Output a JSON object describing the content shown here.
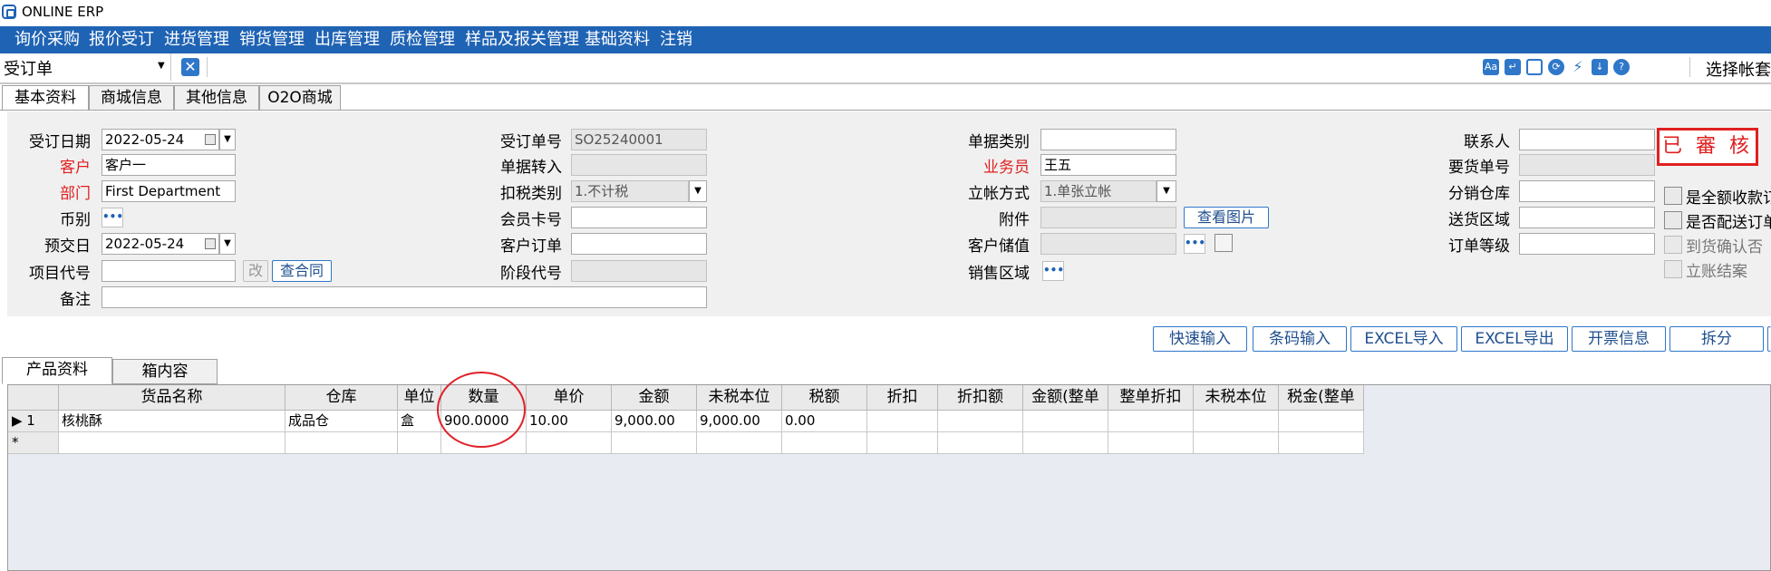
{
  "app": {
    "title": "ONLINE ERP"
  },
  "menu": [
    "询价采购",
    "报价受订",
    "进货管理",
    "销货管理",
    "出库管理",
    "质检管理",
    "样品及报关管理",
    "基础资料",
    "注销"
  ],
  "toolbar": {
    "doc_type": "受订单",
    "icons": [
      "aa-icon",
      "export-icon",
      "window-icon",
      "refresh-icon",
      "flow-icon",
      "download-icon",
      "help-icon"
    ],
    "account_label": "选择帐套"
  },
  "tabs": [
    "基本资料",
    "商城信息",
    "其他信息",
    "O2O商城"
  ],
  "form": {
    "order_date": {
      "label": "受订日期",
      "value": "2022-05-24"
    },
    "customer": {
      "label": "客户",
      "value": "客户一"
    },
    "department": {
      "label": "部门",
      "value": "First Department"
    },
    "currency": {
      "label": "币别"
    },
    "delivery_date": {
      "label": "预交日",
      "value": "2022-05-24"
    },
    "project_code": {
      "label": "项目代号",
      "edit_btn": "改",
      "contract_btn": "查合同"
    },
    "remark": {
      "label": "备注"
    },
    "order_no": {
      "label": "受订单号",
      "value": "SO25240001"
    },
    "doc_transfer": {
      "label": "单据转入"
    },
    "tax_type": {
      "label": "扣税类别",
      "value": "1.不计税"
    },
    "member_card": {
      "label": "会员卡号"
    },
    "customer_order": {
      "label": "客户订单"
    },
    "stage_code": {
      "label": "阶段代号"
    },
    "doc_category": {
      "label": "单据类别"
    },
    "salesperson": {
      "label": "业务员",
      "value": "王五"
    },
    "account_method": {
      "label": "立帐方式",
      "value": "1.单张立帐"
    },
    "attachment": {
      "label": "附件",
      "btn": "查看图片"
    },
    "customer_stored": {
      "label": "客户储值"
    },
    "sales_region": {
      "label": "销售区域"
    },
    "contact": {
      "label": "联系人"
    },
    "request_no": {
      "label": "要货单号"
    },
    "dist_warehouse": {
      "label": "分销仓库"
    },
    "delivery_region": {
      "label": "送货区域"
    },
    "order_level": {
      "label": "订单等级"
    },
    "stamp": "已 審 核",
    "checkboxes": [
      "是全额收款订",
      "是否配送订单",
      "到货确认否",
      "立账结案"
    ]
  },
  "actions": [
    "快速输入",
    "条码输入",
    "EXCEL导入",
    "EXCEL导出",
    "开票信息",
    "拆分"
  ],
  "sub_tabs": [
    "产品资料",
    "箱内容"
  ],
  "grid": {
    "headers": [
      "货品名称",
      "仓库",
      "单位",
      "数量",
      "单价",
      "金额",
      "未税本位",
      "税额",
      "折扣",
      "折扣额",
      "金额(整单",
      "整单折扣",
      "未税本位",
      "税金(整单"
    ],
    "rows": [
      {
        "marker": "▶ 1",
        "cells": [
          "核桃酥",
          "成品仓",
          "盒",
          "900.0000",
          "10.00",
          "9,000.00",
          "9,000.00",
          "0.00",
          "",
          "",
          "",
          "",
          "",
          ""
        ]
      }
    ],
    "new_row_marker": "*"
  }
}
